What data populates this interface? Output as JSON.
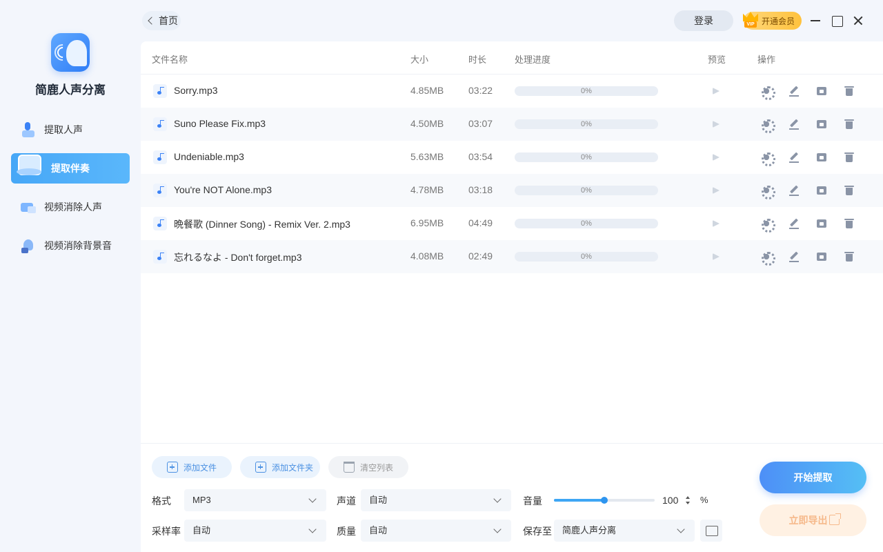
{
  "app": {
    "title": "简鹿人声分离",
    "brand_color": "#3b82f6"
  },
  "sidebar": {
    "items": [
      {
        "label": "提取人声",
        "icon": "mic-person-icon",
        "active": false
      },
      {
        "label": "提取伴奏",
        "icon": "accompaniment-box-icon",
        "active": true
      },
      {
        "label": "视频消除人声",
        "icon": "video-icon",
        "active": false
      },
      {
        "label": "视频消除背景音",
        "icon": "speaker-icon",
        "active": false
      }
    ]
  },
  "topbar": {
    "back_label": "首页",
    "login_label": "登录",
    "vip_label": "开通会员"
  },
  "table": {
    "headers": {
      "name": "文件名称",
      "size": "大小",
      "duration": "时长",
      "progress": "处理进度",
      "preview": "预览",
      "actions": "操作"
    },
    "rows": [
      {
        "name": "Sorry.mp3",
        "size": "4.85MB",
        "duration": "03:22",
        "progress": "0%"
      },
      {
        "name": "Suno Please Fix.mp3",
        "size": "4.50MB",
        "duration": "03:07",
        "progress": "0%"
      },
      {
        "name": "Undeniable.mp3",
        "size": "5.63MB",
        "duration": "03:54",
        "progress": "0%"
      },
      {
        "name": "You're NOT Alone.mp3",
        "size": "4.78MB",
        "duration": "03:18",
        "progress": "0%"
      },
      {
        "name": "晩餐歌 (Dinner Song) - Remix Ver. 2.mp3",
        "size": "6.95MB",
        "duration": "04:49",
        "progress": "0%"
      },
      {
        "name": "忘れるなよ - Don't forget.mp3",
        "size": "4.08MB",
        "duration": "02:49",
        "progress": "0%"
      }
    ]
  },
  "bottom": {
    "add_file": "添加文件",
    "add_folder": "添加文件夹",
    "clear_list": "清空列表",
    "format_label": "格式",
    "format_value": "MP3",
    "channel_label": "声道",
    "channel_value": "自动",
    "volume_label": "音量",
    "volume_value": "100",
    "volume_percent": 0.5,
    "percent_sign": "%",
    "samplerate_label": "采样率",
    "samplerate_value": "自动",
    "quality_label": "质量",
    "quality_value": "自动",
    "saveto_label": "保存至",
    "saveto_value": "简鹿人声分离",
    "start_label": "开始提取",
    "export_label": "立即导出"
  }
}
